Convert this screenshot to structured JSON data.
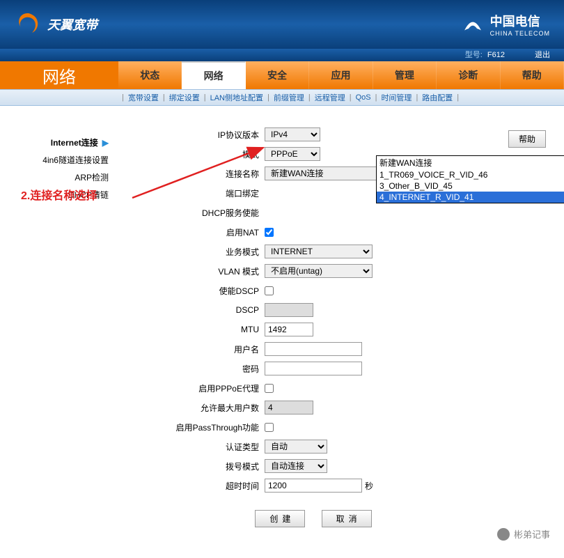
{
  "header": {
    "brand_left": "天翼宽带",
    "brand_right_cn": "中国电信",
    "brand_right_en": "CHINA TELECOM"
  },
  "model_bar": {
    "label": "型号:",
    "value": "F612",
    "exit": "退出"
  },
  "nav": {
    "title": "网络",
    "tabs": [
      "状态",
      "网络",
      "安全",
      "应用",
      "管理",
      "诊断",
      "帮助"
    ],
    "active": 1
  },
  "subnav": [
    "宽带设置",
    "绑定设置",
    "LAN侧地址配置",
    "前缀管理",
    "远程管理",
    "QoS",
    "时间管理",
    "路由配置"
  ],
  "sidebar": [
    {
      "label": "Internet连接",
      "active": true
    },
    {
      "label": "4in6隧道连接设置",
      "active": false
    },
    {
      "label": "ARP检测",
      "active": false
    },
    {
      "label": "DHCP清链",
      "active": false
    }
  ],
  "annotation": "2.连接名称选择",
  "form": {
    "ip_ver_label": "IP协议版本",
    "ip_ver": "IPv4",
    "mode_label": "模式",
    "mode": "PPPoE",
    "conn_label": "连接名称",
    "conn": "新建WAN连接",
    "conn_options": [
      "新建WAN连接",
      "1_TR069_VOICE_R_VID_46",
      "3_Other_B_VID_45",
      "4_INTERNET_R_VID_41"
    ],
    "conn_highlight": 3,
    "portbind_label": "端口绑定",
    "dhcp_enable_label": "DHCP服务使能",
    "nat_label": "启用NAT",
    "nat_checked": true,
    "bizmode_label": "业务模式",
    "bizmode": "INTERNET",
    "vlan_label": "VLAN 模式",
    "vlan": "不启用(untag)",
    "dscp_en_label": "使能DSCP",
    "dscp_en_checked": false,
    "dscp_label": "DSCP",
    "dscp": "",
    "mtu_label": "MTU",
    "mtu": "1492",
    "user_label": "用户名",
    "user": "",
    "pass_label": "密码",
    "pass": "",
    "pppoe_proxy_label": "启用PPPoE代理",
    "pppoe_proxy_checked": false,
    "maxuser_label": "允许最大用户数",
    "maxuser": "4",
    "passthrough_label": "启用PassThrough功能",
    "passthrough_checked": false,
    "auth_label": "认证类型",
    "auth": "自动",
    "dial_label": "拨号模式",
    "dial": "自动连接",
    "timeout_label": "超时时间",
    "timeout": "1200",
    "timeout_unit": "秒"
  },
  "buttons": {
    "help": "帮助",
    "create": "创建",
    "cancel": "取消"
  },
  "watermark": "彬弟记事"
}
